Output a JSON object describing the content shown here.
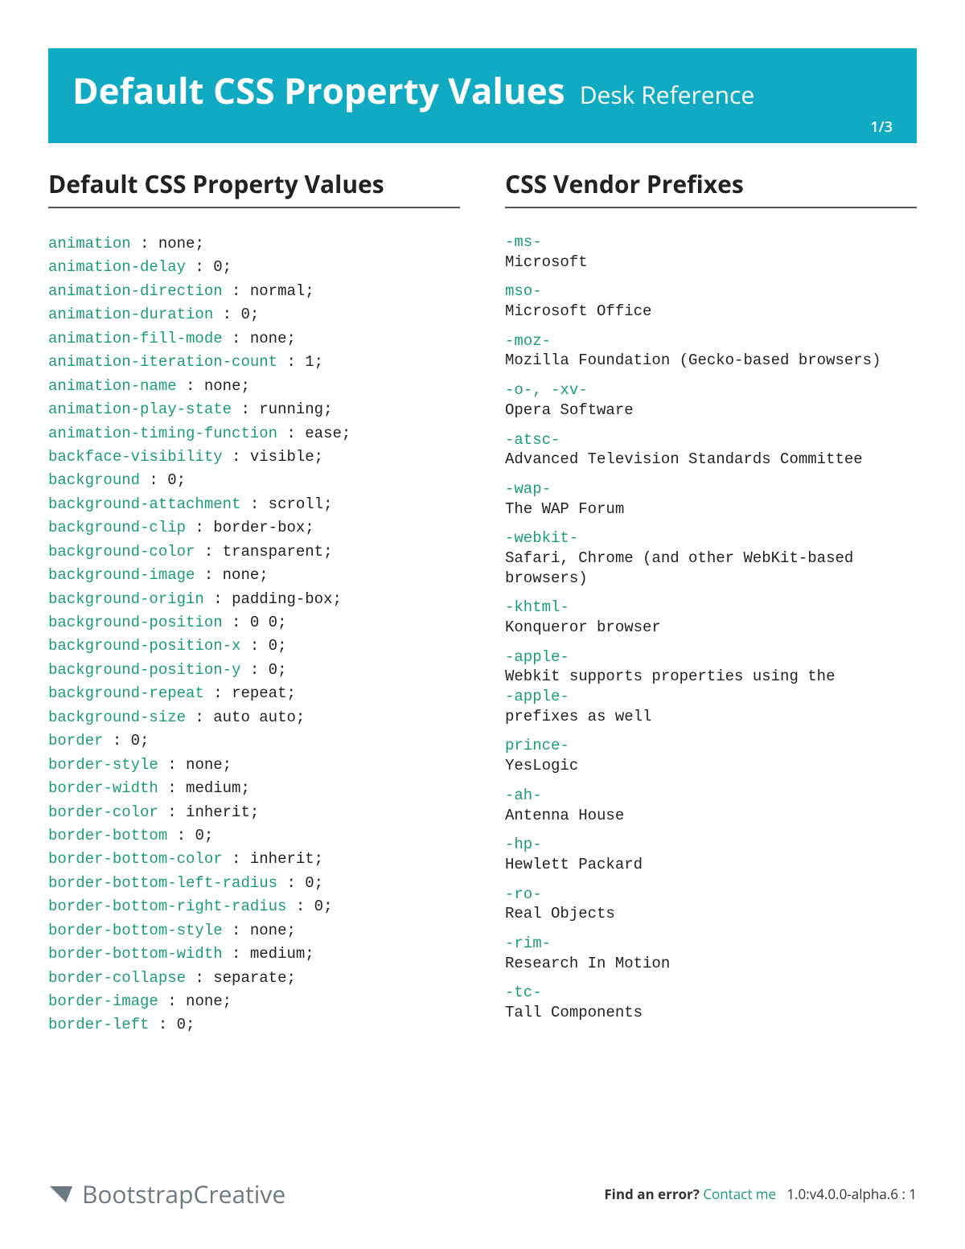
{
  "banner": {
    "title": "Default CSS Property Values",
    "subtitle": "Desk Reference",
    "page_indicator": "1/3"
  },
  "left": {
    "heading": "Default CSS Property Values",
    "properties": [
      {
        "name": "animation",
        "value": "none"
      },
      {
        "name": "animation-delay",
        "value": "0"
      },
      {
        "name": "animation-direction",
        "value": "normal"
      },
      {
        "name": "animation-duration",
        "value": "0"
      },
      {
        "name": "animation-fill-mode",
        "value": "none"
      },
      {
        "name": "animation-iteration-count",
        "value": "1"
      },
      {
        "name": "animation-name",
        "value": "none"
      },
      {
        "name": "animation-play-state",
        "value": "running"
      },
      {
        "name": "animation-timing-function",
        "value": "ease"
      },
      {
        "name": "backface-visibility",
        "value": "visible"
      },
      {
        "name": "background",
        "value": "0"
      },
      {
        "name": "background-attachment",
        "value": "scroll"
      },
      {
        "name": "background-clip",
        "value": "border-box"
      },
      {
        "name": "background-color",
        "value": "transparent"
      },
      {
        "name": "background-image",
        "value": "none"
      },
      {
        "name": "background-origin",
        "value": "padding-box"
      },
      {
        "name": "background-position",
        "value": "0 0"
      },
      {
        "name": "background-position-x",
        "value": "0"
      },
      {
        "name": "background-position-y",
        "value": "0"
      },
      {
        "name": "background-repeat",
        "value": "repeat"
      },
      {
        "name": "background-size",
        "value": "auto auto"
      },
      {
        "name": "border",
        "value": "0"
      },
      {
        "name": "border-style",
        "value": "none"
      },
      {
        "name": "border-width",
        "value": "medium"
      },
      {
        "name": "border-color",
        "value": "inherit"
      },
      {
        "name": "border-bottom",
        "value": "0"
      },
      {
        "name": "border-bottom-color",
        "value": "inherit"
      },
      {
        "name": "border-bottom-left-radius",
        "value": "0"
      },
      {
        "name": "border-bottom-right-radius",
        "value": "0"
      },
      {
        "name": "border-bottom-style",
        "value": "none"
      },
      {
        "name": "border-bottom-width",
        "value": "medium"
      },
      {
        "name": "border-collapse",
        "value": "separate"
      },
      {
        "name": "border-image",
        "value": "none"
      },
      {
        "name": "border-left",
        "value": "0"
      }
    ]
  },
  "right": {
    "heading": "CSS Vendor Prefixes",
    "prefixes": [
      {
        "tag": "-ms-",
        "desc": "Microsoft"
      },
      {
        "tag": "mso-",
        "desc": "Microsoft Office"
      },
      {
        "tag": "-moz-",
        "desc": "Mozilla Foundation (Gecko-based browsers)"
      },
      {
        "tag": "-o-, -xv-",
        "desc": "Opera Software"
      },
      {
        "tag": "-atsc-",
        "desc": "Advanced Television Standards Committee"
      },
      {
        "tag": "-wap-",
        "desc": "The WAP Forum"
      },
      {
        "tag": "-webkit-",
        "desc": "Safari, Chrome (and other WebKit-based browsers)"
      },
      {
        "tag": "-khtml-",
        "desc": "Konqueror browser"
      },
      {
        "tag": "-apple-",
        "desc": "Webkit supports properties using the",
        "tag2": "-apple-",
        "desc2": "prefixes as well"
      },
      {
        "tag": "prince-",
        "desc": "YesLogic"
      },
      {
        "tag": "-ah-",
        "desc": "Antenna House"
      },
      {
        "tag": "-hp-",
        "desc": "Hewlett Packard"
      },
      {
        "tag": "-ro-",
        "desc": "Real Objects"
      },
      {
        "tag": "-rim-",
        "desc": "Research In Motion"
      },
      {
        "tag": "-tc-",
        "desc": "Tall Components"
      }
    ]
  },
  "footer": {
    "brand": "BootstrapCreative",
    "error_label": "Find an error?",
    "contact_link": "Contact me",
    "version": "1.0:v4.0.0-alpha.6 : 1"
  }
}
